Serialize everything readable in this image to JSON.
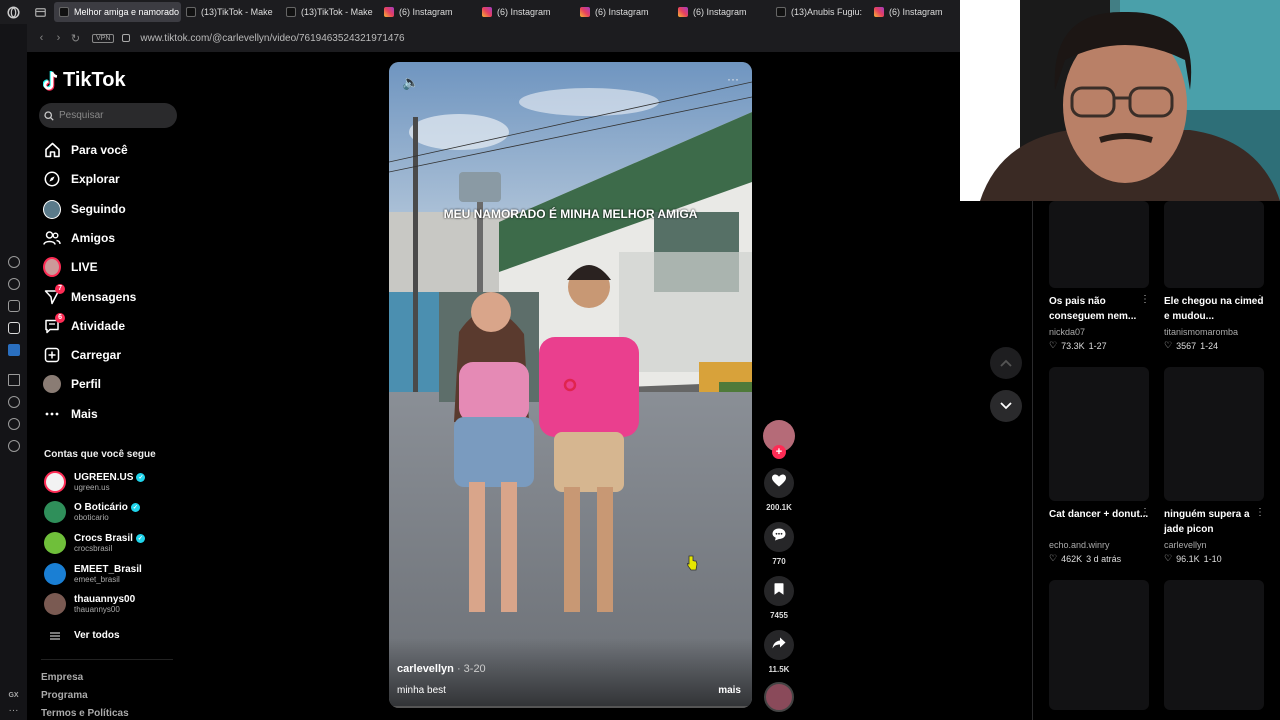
{
  "browser": {
    "tabs": [
      {
        "label": "Melhor amiga e namorado",
        "icon": "tiktok-icon",
        "active": true
      },
      {
        "label": "(13)TikTok - Make",
        "icon": "tiktok-icon"
      },
      {
        "label": "(13)TikTok - Make",
        "icon": "tiktok-icon"
      },
      {
        "label": "(6) Instagram",
        "icon": "instagram-icon"
      },
      {
        "label": "(6) Instagram",
        "icon": "instagram-icon"
      },
      {
        "label": "(6) Instagram",
        "icon": "instagram-icon"
      },
      {
        "label": "(6) Instagram",
        "icon": "instagram-icon"
      },
      {
        "label": "(13)Anubis Fugiu:",
        "icon": "tiktok-icon"
      },
      {
        "label": "(6) Instagram",
        "icon": "instagram-icon"
      }
    ],
    "vpn_label": "VPN",
    "url": "www.tiktok.com/@carlevellyn/video/7619463524321971476",
    "rail_bottom_label": "GX"
  },
  "sidebar": {
    "logo_text": "TikTok",
    "search_placeholder": "Pesquisar",
    "menu": [
      {
        "label": "Para você",
        "icon": "home-icon"
      },
      {
        "label": "Explorar",
        "icon": "compass-icon"
      },
      {
        "label": "Seguindo",
        "icon": "following-avatar-icon"
      },
      {
        "label": "Amigos",
        "icon": "friends-icon"
      },
      {
        "label": "LIVE",
        "icon": "live-avatar-icon"
      },
      {
        "label": "Mensagens",
        "icon": "messages-icon",
        "badge": "7"
      },
      {
        "label": "Atividade",
        "icon": "activity-icon",
        "badge": "6"
      },
      {
        "label": "Carregar",
        "icon": "upload-icon"
      },
      {
        "label": "Perfil",
        "icon": "profile-avatar-icon"
      },
      {
        "label": "Mais",
        "icon": "more-icon"
      }
    ],
    "following_title": "Contas que você segue",
    "accounts": [
      {
        "name": "UGREEN.US",
        "handle": "ugreen.us",
        "verified": true,
        "color": "#f2f2f2"
      },
      {
        "name": "O Boticário",
        "handle": "oboticario",
        "verified": true,
        "color": "#2f8f5a"
      },
      {
        "name": "Crocs Brasil",
        "handle": "crocsbrasil",
        "verified": true,
        "color": "#6fbf3a"
      },
      {
        "name": "EMEET_Brasil",
        "handle": "emeet_brasil",
        "verified": false,
        "color": "#1a7fd4"
      },
      {
        "name": "thauannys00",
        "handle": "thauannys00",
        "verified": false,
        "color": "#7a5a52"
      }
    ],
    "see_all": "Ver todos",
    "footer": [
      "Empresa",
      "Programa",
      "Termos e Políticas"
    ]
  },
  "video": {
    "caption_overlay": "MEU NAMORADO É MINHA MELHOR AMIGA",
    "author": "carlevellyn",
    "date": "· 3-20",
    "description": "minha best",
    "more_label": "mais",
    "likes": "200.1K",
    "comments": "770",
    "saves": "7455",
    "shares": "11.5K"
  },
  "related": [
    {
      "title": "Os pais não conseguem nem...",
      "author": "nickda07",
      "likes": "73.3K",
      "date": "1-27"
    },
    {
      "title": "Ele chegou na cimed e mudou...",
      "author": "titanismomaromba",
      "likes": "3567",
      "date": "1-24"
    },
    {
      "title": "Cat dancer + donut...",
      "author": "echo.and.winry",
      "likes": "462K",
      "date": "3 d atrás"
    },
    {
      "title": "ninguém supera a jade picon",
      "author": "carlevellyn",
      "likes": "96.1K",
      "date": "1-10"
    }
  ],
  "colors": {
    "brand": "#fe2c55",
    "accent": "#25f4ee",
    "verified": "#20d5ec"
  }
}
